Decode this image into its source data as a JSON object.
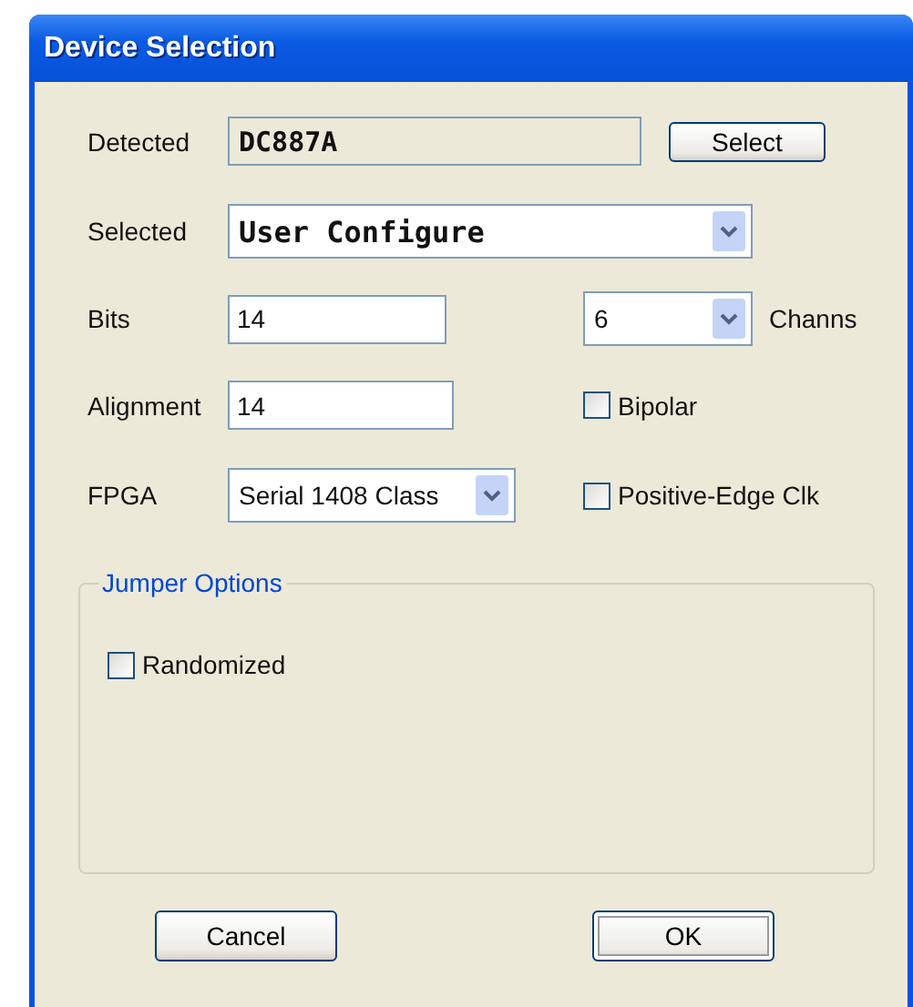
{
  "window": {
    "title": "Device Selection"
  },
  "detected": {
    "label": "Detected",
    "value": "DC887A",
    "button": "Select"
  },
  "selected": {
    "label": "Selected",
    "value": "User Configure"
  },
  "bits": {
    "label": "Bits",
    "value": "14"
  },
  "channels": {
    "value": "6",
    "label": "Channs"
  },
  "alignment": {
    "label": "Alignment",
    "value": "14"
  },
  "bipolar": {
    "label": "Bipolar",
    "checked": false
  },
  "fpga": {
    "label": "FPGA",
    "value": "Serial 1408 Class"
  },
  "positive_edge_clk": {
    "label": "Positive-Edge Clk",
    "checked": false
  },
  "jumper_options": {
    "title": "Jumper Options",
    "options": [
      {
        "label": "Randomized",
        "checked": false
      }
    ]
  },
  "buttons": [
    {
      "label": "Cancel",
      "default": false
    },
    {
      "label": "OK",
      "default": true
    }
  ]
}
